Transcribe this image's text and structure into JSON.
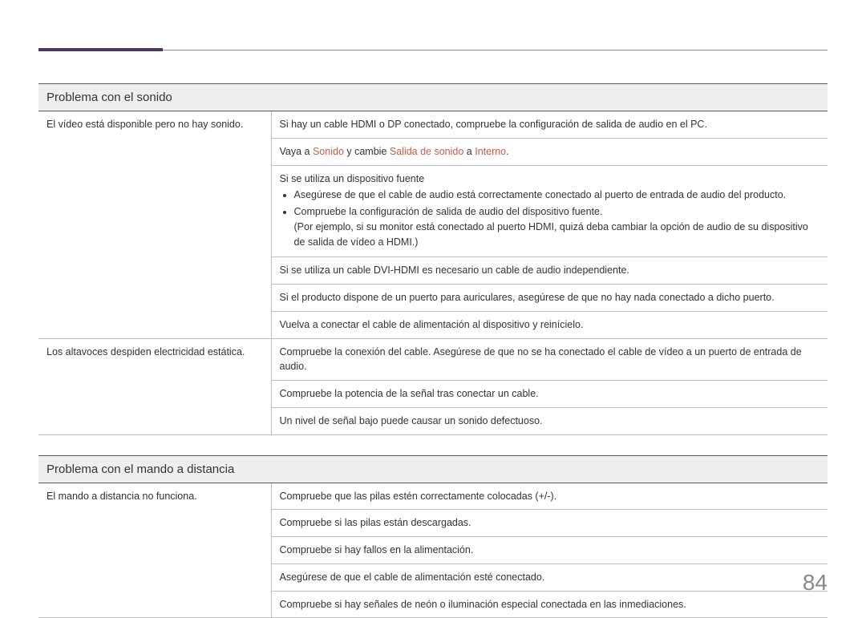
{
  "page_number": "84",
  "sections": [
    {
      "title": "Problema con el sonido",
      "rows": [
        {
          "left": "El vídeo está disponible pero no hay sonido.",
          "rights": [
            {
              "type": "text",
              "content": "Si hay un cable HDMI o DP conectado, compruebe la configuración de salida de audio en el PC."
            },
            {
              "type": "mixed",
              "parts": [
                {
                  "t": "Vaya a "
                },
                {
                  "t": "Sonido",
                  "hl": true
                },
                {
                  "t": " y cambie "
                },
                {
                  "t": "Salida de sonido",
                  "hl": true
                },
                {
                  "t": " a "
                },
                {
                  "t": "Interno",
                  "hl": true
                },
                {
                  "t": "."
                }
              ]
            },
            {
              "type": "intro_list",
              "intro": "Si se utiliza un dispositivo fuente",
              "items": [
                "Asegúrese de que el cable de audio está correctamente conectado al puerto de entrada de audio del producto.",
                "Compruebe la configuración de salida de audio del dispositivo fuente.\n(Por ejemplo, si su monitor está conectado al puerto HDMI, quizá deba cambiar la opción de audio de su dispositivo de salida de vídeo a HDMI.)"
              ]
            },
            {
              "type": "text",
              "content": "Si se utiliza un cable DVI-HDMI es necesario un cable de audio independiente."
            },
            {
              "type": "text",
              "content": "Si el producto dispone de un puerto para auriculares, asegúrese de que no hay nada conectado a dicho puerto."
            },
            {
              "type": "text",
              "content": "Vuelva a conectar el cable de alimentación al dispositivo y reinícielo."
            }
          ]
        },
        {
          "left": "Los altavoces despiden electricidad estática.",
          "rights": [
            {
              "type": "text",
              "content": "Compruebe la conexión del cable. Asegúrese de que no se ha conectado el cable de vídeo a un puerto de entrada de audio."
            },
            {
              "type": "text",
              "content": "Compruebe la potencia de la señal tras conectar un cable."
            },
            {
              "type": "text",
              "content": "Un nivel de señal bajo puede causar un sonido defectuoso."
            }
          ]
        }
      ]
    },
    {
      "title": "Problema con el mando a distancia",
      "rows": [
        {
          "left": "El mando a distancia no funciona.",
          "rights": [
            {
              "type": "text",
              "content": "Compruebe que las pilas estén correctamente colocadas (+/-)."
            },
            {
              "type": "text",
              "content": "Compruebe si las pilas están descargadas."
            },
            {
              "type": "text",
              "content": "Compruebe si hay fallos en la alimentación."
            },
            {
              "type": "text",
              "content": "Asegúrese de que el cable de alimentación esté conectado."
            },
            {
              "type": "text",
              "content": "Compruebe si hay señales de neón o iluminación especial conectada en las inmediaciones."
            }
          ]
        }
      ]
    }
  ]
}
